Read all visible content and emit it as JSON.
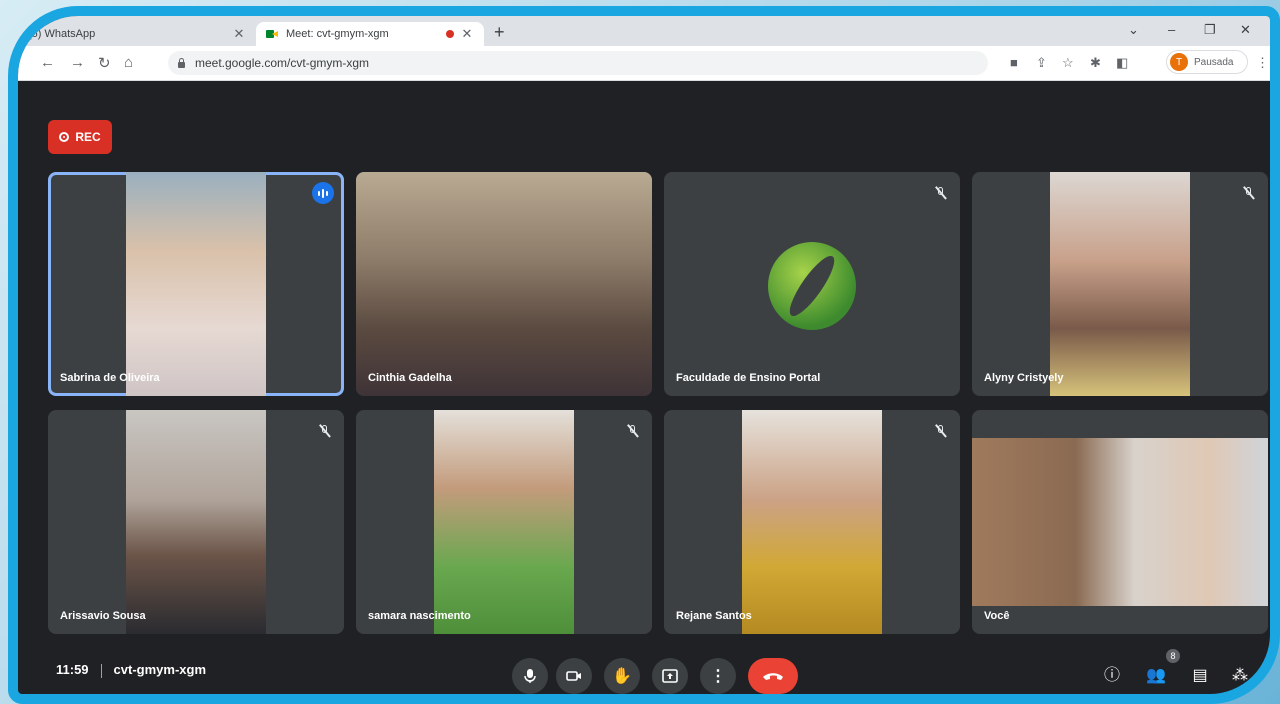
{
  "browser": {
    "tabs": [
      {
        "label": "(6) WhatsApp"
      },
      {
        "label": "Meet: cvt-gmym-xgm"
      }
    ],
    "url": "meet.google.com/cvt-gmym-xgm",
    "profile_initial": "T",
    "profile_status": "Pausada"
  },
  "meeting": {
    "rec_label": "REC",
    "time": "11:59",
    "code": "cvt-gmym-xgm",
    "participant_count": "8",
    "participants": [
      {
        "name": "Sabrina de Oliveira",
        "speaking": true
      },
      {
        "name": "Cinthia Gadelha"
      },
      {
        "name": "Faculdade de Ensino Portal",
        "muted": true
      },
      {
        "name": "Alyny Cristyely",
        "muted": true
      },
      {
        "name": "Arissavio Sousa",
        "muted": true
      },
      {
        "name": "samara nascimento",
        "muted": true
      },
      {
        "name": "Rejane Santos",
        "muted": true
      },
      {
        "name": "Você"
      }
    ]
  },
  "colors": {
    "accent": "#1a73e8",
    "rec": "#d93025",
    "end_call": "#ea4335",
    "frame": "#1aa6e0"
  }
}
